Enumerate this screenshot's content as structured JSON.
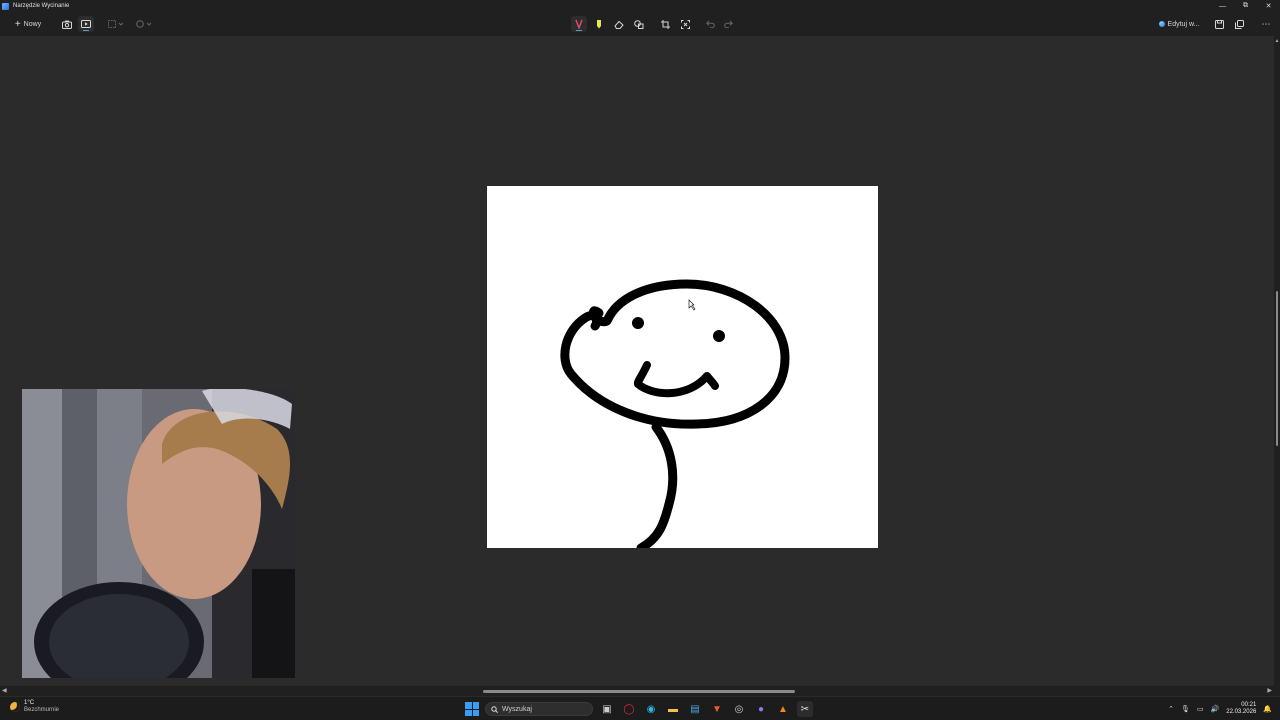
{
  "window": {
    "title": "Narzędzie Wycinanie",
    "controls": {
      "minimize": "—",
      "maximize": "⧉",
      "close": "✕"
    }
  },
  "toolbar": {
    "new_label": "Nowy",
    "edit_label": "Edytuj w...",
    "more_label": "⋯",
    "accent_color": "#4ca0e0"
  },
  "taskbar": {
    "weather_temp": "1°C",
    "weather_desc": "Bezchmurnie",
    "search_placeholder": "Wyszukaj",
    "time": "00:21",
    "date": "22.03.2026"
  },
  "colors": {
    "canvas_bg": "#2b2b2b",
    "chrome_bg": "#202020",
    "taskbar_bg": "#1c1c1c",
    "windows_blue": "#3a9df4"
  }
}
